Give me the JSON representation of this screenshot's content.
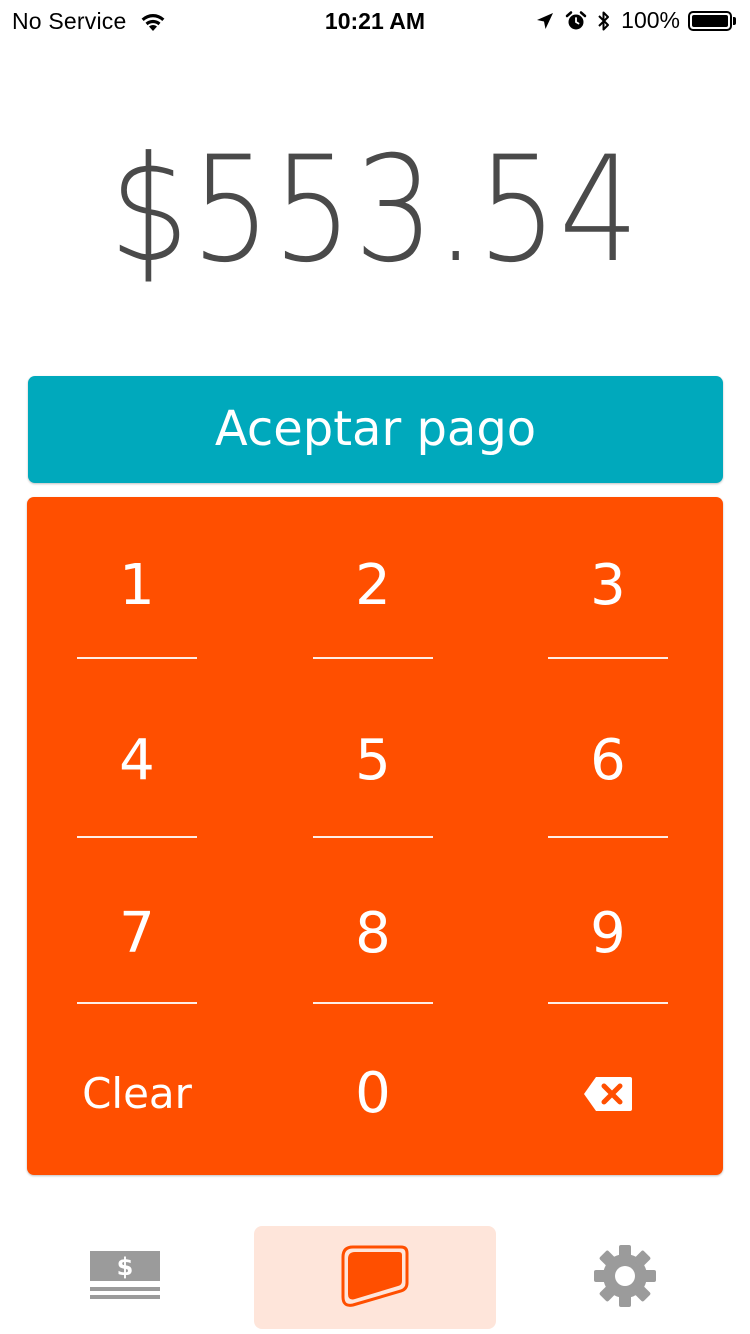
{
  "status_bar": {
    "carrier": "No Service",
    "time": "10:21 AM",
    "battery_percent": "100%",
    "battery_level": 1.0,
    "icons": [
      "wifi-icon",
      "location-arrow-icon",
      "alarm-icon",
      "bluetooth-icon",
      "battery-icon"
    ]
  },
  "amount": {
    "display": "$553.54"
  },
  "accept_button": {
    "label": "Aceptar pago",
    "color": "#00a9bc"
  },
  "keypad": {
    "color": "#ff4f00",
    "keys": {
      "k1": "1",
      "k2": "2",
      "k3": "3",
      "k4": "4",
      "k5": "5",
      "k6": "6",
      "k7": "7",
      "k8": "8",
      "k9": "9",
      "clear": "Clear",
      "k0": "0",
      "backspace_icon": "backspace-icon"
    }
  },
  "tab_bar": {
    "tabs": [
      {
        "icon": "cash-icon",
        "selected": false
      },
      {
        "icon": "card-icon",
        "selected": true
      },
      {
        "icon": "gear-icon",
        "selected": false
      }
    ],
    "active_color": "#ff4f00",
    "active_bg": "#fee5da",
    "inactive_color": "#9b9b9b"
  }
}
